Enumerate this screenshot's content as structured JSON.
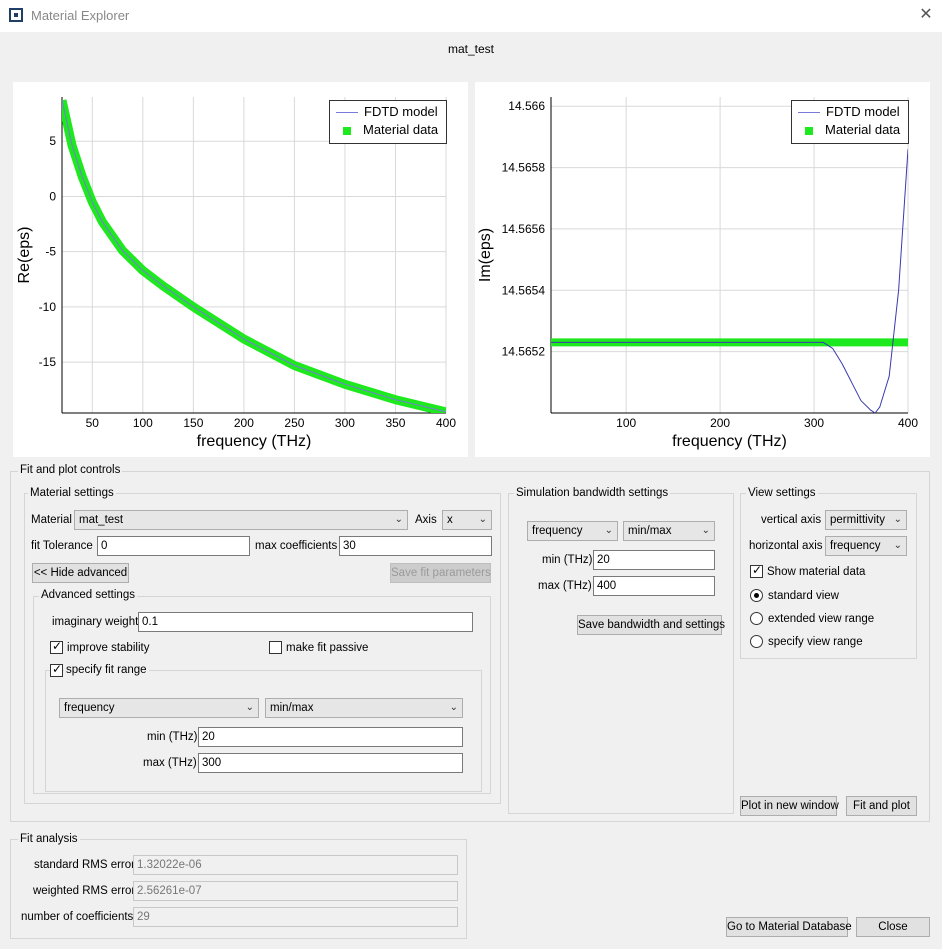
{
  "window": {
    "title": "Material Explorer",
    "subtitle": "mat_test"
  },
  "chart_data": [
    {
      "type": "line",
      "xlabel": "frequency (THz)",
      "ylabel": "Re(eps)",
      "xlim": [
        20,
        400
      ],
      "ylim": [
        -19.6,
        9
      ],
      "xticks": [
        50,
        100,
        150,
        200,
        250,
        300,
        350,
        400
      ],
      "yticks": [
        5,
        0,
        -5,
        -10,
        -15
      ],
      "grid": true,
      "legend_position": "top-right",
      "series": [
        {
          "name": "FDTD model",
          "style": "thin-line",
          "color": "#7a7adb",
          "x": [
            20,
            30,
            40,
            50,
            60,
            80,
            100,
            120,
            150,
            200,
            250,
            300,
            350,
            400
          ],
          "y": [
            8.7,
            4.6,
            1.8,
            -0.5,
            -2.3,
            -4.9,
            -6.7,
            -8.1,
            -10.0,
            -12.9,
            -15.3,
            -17.0,
            -18.4,
            -19.5
          ]
        },
        {
          "name": "Material data",
          "style": "thick-line",
          "color": "#1ee81e",
          "x": [
            20,
            30,
            40,
            50,
            60,
            80,
            100,
            120,
            150,
            200,
            250,
            300,
            350,
            400
          ],
          "y": [
            8.7,
            4.6,
            1.8,
            -0.5,
            -2.3,
            -4.9,
            -6.7,
            -8.1,
            -10.0,
            -12.9,
            -15.3,
            -17.0,
            -18.4,
            -19.5
          ]
        }
      ]
    },
    {
      "type": "line",
      "xlabel": "frequency (THz)",
      "ylabel": "Im(eps)",
      "xlim": [
        20,
        400
      ],
      "ylim": [
        14.565,
        14.56603
      ],
      "xticks": [
        100,
        200,
        300,
        400
      ],
      "yticks": [
        14.566,
        14.5658,
        14.5656,
        14.5654,
        14.5652
      ],
      "grid": true,
      "legend_position": "top-right",
      "series": [
        {
          "name": "FDTD model",
          "style": "thin-line",
          "color": "#3a3ab0",
          "x": [
            20,
            100,
            200,
            300,
            310,
            320,
            330,
            340,
            350,
            360,
            365,
            370,
            380,
            390,
            400
          ],
          "y": [
            14.56523,
            14.56523,
            14.56523,
            14.56523,
            14.56523,
            14.56521,
            14.56516,
            14.5651,
            14.56504,
            14.56501,
            14.565,
            14.56502,
            14.56512,
            14.5654,
            14.56586
          ]
        },
        {
          "name": "Material data",
          "style": "thick-line",
          "color": "#1ee81e",
          "x": [
            20,
            400
          ],
          "y": [
            14.56523,
            14.56523
          ]
        }
      ]
    }
  ],
  "controls": {
    "title": "Fit and plot controls",
    "material_settings": {
      "title": "Material settings",
      "material_label": "Material",
      "material_value": "mat_test",
      "axis_label": "Axis",
      "axis_value": "x",
      "fit_tolerance_label": "fit Tolerance",
      "fit_tolerance_value": "0",
      "max_coeff_label": "max coefficients",
      "max_coeff_value": "30",
      "hide_advanced": "<< Hide advanced",
      "save_fit": "Save fit parameters",
      "advanced": {
        "title": "Advanced settings",
        "imag_weight_label": "imaginary weight",
        "imag_weight_value": "0.1",
        "improve_stability": "improve stability",
        "make_fit_passive": "make fit passive",
        "specify_fit_range": "specify fit range",
        "range_type": "frequency",
        "range_mode": "min/max",
        "min_label": "min (THz)",
        "min_value": "20",
        "max_label": "max (THz)",
        "max_value": "300"
      }
    },
    "simulation": {
      "title": "Simulation bandwidth settings",
      "type": "frequency",
      "mode": "min/max",
      "min_label": "min (THz)",
      "min_value": "20",
      "max_label": "max (THz)",
      "max_value": "400",
      "save": "Save bandwidth and settings"
    },
    "view": {
      "title": "View settings",
      "vertical_label": "vertical axis",
      "vertical_value": "permittivity",
      "horizontal_label": "horizontal axis",
      "horizontal_value": "frequency",
      "show_material": "Show material data",
      "standard_view": "standard view",
      "extended_view": "extended view range",
      "specify_view": "specify view range"
    },
    "plot_new_window": "Plot in new window",
    "fit_and_plot": "Fit and plot"
  },
  "analysis": {
    "title": "Fit analysis",
    "std_rms_label": "standard RMS error",
    "std_rms_value": "1.32022e-06",
    "weighted_rms_label": "weighted RMS error",
    "weighted_rms_value": "2.56261e-07",
    "num_coeff_label": "number of coefficients",
    "num_coeff_value": "29"
  },
  "footer": {
    "go_to_db": "Go to Material Database",
    "close": "Close"
  }
}
